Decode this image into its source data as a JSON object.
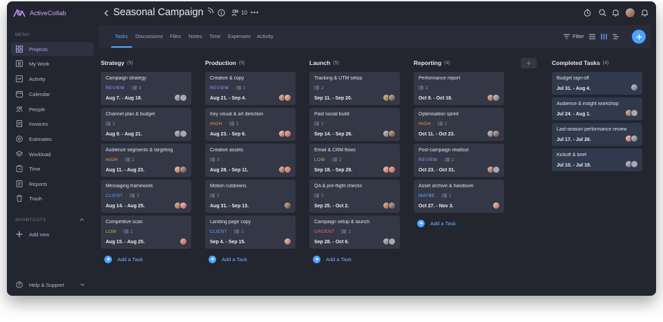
{
  "app": {
    "name": "ActiveCollab"
  },
  "project": {
    "title": "Seasonal Campaign",
    "people_count": "10"
  },
  "sidebar": {
    "menu_heading": "MENU",
    "items": [
      {
        "label": "Projects",
        "icon": "grid-icon",
        "active": true
      },
      {
        "label": "My Work",
        "icon": "user-card-icon"
      },
      {
        "label": "Activity",
        "icon": "activity-icon"
      },
      {
        "label": "Calendar",
        "icon": "calendar-icon"
      },
      {
        "label": "People",
        "icon": "people-icon"
      },
      {
        "label": "Invoices",
        "icon": "invoice-icon"
      },
      {
        "label": "Estimates",
        "icon": "estimate-icon"
      },
      {
        "label": "Workload",
        "icon": "layers-icon"
      },
      {
        "label": "Time",
        "icon": "timer-icon"
      },
      {
        "label": "Reports",
        "icon": "report-icon"
      },
      {
        "label": "Trash",
        "icon": "trash-icon"
      }
    ],
    "shortcuts_heading": "SHORTCUTS",
    "add_new": "Add new",
    "help": "Help & Support"
  },
  "tabs": [
    "Tasks",
    "Discussions",
    "Files",
    "Notes",
    "Time",
    "Expenses",
    "Activity"
  ],
  "toolbar": {
    "filter": "Filter"
  },
  "add_task_label": "Add a Task",
  "columns": [
    {
      "name": "Strategy",
      "count": "(5)",
      "cards": [
        {
          "title": "Campaign strategy",
          "tag": "REVIEW",
          "tag_class": "review",
          "subtasks": "3",
          "dates": "Aug 7. - Aug 18.",
          "avatars": [
            "a3",
            "a4"
          ]
        },
        {
          "title": "Channel plan & budget",
          "tag": "",
          "subtasks": "2",
          "dates": "Aug 9. - Aug 21.",
          "avatars": [
            "a3",
            "a4"
          ]
        },
        {
          "title": "Audience segments & targeting",
          "tag": "HIGH",
          "tag_class": "high",
          "subtasks": "2",
          "dates": "Aug 11. - Aug 23.",
          "avatars": [
            "a2",
            "a5"
          ]
        },
        {
          "title": "Messaging framework",
          "tag": "CLIENT",
          "tag_class": "client",
          "subtasks": "2",
          "dates": "Aug 14. - Aug 25.",
          "avatars": [
            "a1",
            "a2"
          ]
        },
        {
          "title": "Competitive scan",
          "tag": "LOW",
          "tag_class": "low",
          "subtasks": "1",
          "dates": "Aug 15. - Aug 25.",
          "avatars": [
            "a6"
          ]
        }
      ]
    },
    {
      "name": "Production",
      "count": "(5)",
      "cards": [
        {
          "title": "Creative & copy",
          "tag": "REVIEW",
          "tag_class": "review",
          "subtasks": "2",
          "dates": "Aug 21. - Sep 4.",
          "avatars": [
            "a1",
            "a2"
          ]
        },
        {
          "title": "Key visual & art direction",
          "tag": "HIGH",
          "tag_class": "high",
          "subtasks": "3",
          "dates": "Aug 23. - Sep 6.",
          "avatars": [
            "a2",
            "a6"
          ]
        },
        {
          "title": "Creative assets",
          "tag": "",
          "subtasks": "3",
          "dates": "Aug 28. - Sep 11.",
          "avatars": [
            "a1",
            "a6"
          ]
        },
        {
          "title": "Motion cutdowns",
          "tag": "",
          "subtasks": "2",
          "dates": "Aug 31. - Sep 13.",
          "avatars": [
            "a5"
          ]
        },
        {
          "title": "Landing page copy",
          "tag": "CLIENT",
          "tag_class": "client",
          "subtasks": "1",
          "dates": "Sep 4. - Sep 15.",
          "avatars": [
            "a2"
          ]
        }
      ]
    },
    {
      "name": "Launch",
      "count": "(5)",
      "cards": [
        {
          "title": "Tracking & UTM setup",
          "tag": "",
          "subtasks": "2",
          "dates": "Sep 11. - Sep 20.",
          "avatars": [
            "a1",
            "a5"
          ]
        },
        {
          "title": "Paid social build",
          "tag": "",
          "subtasks": "2",
          "dates": "Sep 14. - Sep 26.",
          "avatars": [
            "a3",
            "a5"
          ]
        },
        {
          "title": "Email & CRM flows",
          "tag": "LOW",
          "tag_class": "low",
          "subtasks": "2",
          "dates": "Sep 18. - Sep 29.",
          "avatars": [
            "a2",
            "a6"
          ]
        },
        {
          "title": "QA & pre-flight checks",
          "tag": "",
          "subtasks": "2",
          "dates": "Sep 25. - Oct 2.",
          "avatars": [
            "a1",
            "a5"
          ]
        },
        {
          "title": "Campaign setup & launch",
          "tag": "URGENT",
          "tag_class": "urgent",
          "subtasks": "2",
          "dates": "Sep 28. - Oct 6.",
          "avatars": [
            "a3",
            "a4"
          ]
        }
      ]
    },
    {
      "name": "Reporting",
      "count": "(4)",
      "cards": [
        {
          "title": "Performance report",
          "tag": "",
          "subtasks": "2",
          "dates": "Oct 9. - Oct 18.",
          "avatars": [
            "a1",
            "a3"
          ]
        },
        {
          "title": "Optimisation sprint",
          "tag": "HIGH",
          "tag_class": "high",
          "subtasks": "2",
          "dates": "Oct 11. - Oct 23.",
          "avatars": [
            "a3",
            "a5"
          ]
        },
        {
          "title": "Post-campaign readout",
          "tag": "REVIEW",
          "tag_class": "review",
          "subtasks": "2",
          "dates": "Oct 23. - Oct 31.",
          "avatars": [
            "a1",
            "a4"
          ]
        },
        {
          "title": "Asset archive & handover",
          "tag": "MAYBE",
          "tag_class": "maybe",
          "subtasks": "1",
          "dates": "Oct 27. - Nov 3.",
          "avatars": [
            "a2"
          ]
        }
      ]
    }
  ],
  "completed": {
    "name": "Completed Tasks",
    "count": "(4)",
    "cards": [
      {
        "title": "Budget sign-off",
        "dates": "Jul 31. - Aug 4.",
        "avatars": [
          "a3"
        ]
      },
      {
        "title": "Audience & insight workshop",
        "dates": "Jul 24. - Aug 1.",
        "avatars": [
          "a1",
          "a4"
        ]
      },
      {
        "title": "Last-season performance review",
        "dates": "Jul 17. - Jul 26.",
        "avatars": [
          "a2",
          "a3"
        ]
      },
      {
        "title": "Kickoff & brief",
        "dates": "Jul 10. - Jul 19.",
        "avatars": [
          "a3",
          "a4"
        ]
      }
    ]
  },
  "colors": {
    "accent": "#4aa3ff",
    "sidebar_active": "#b99af0",
    "background": "#23252f"
  }
}
